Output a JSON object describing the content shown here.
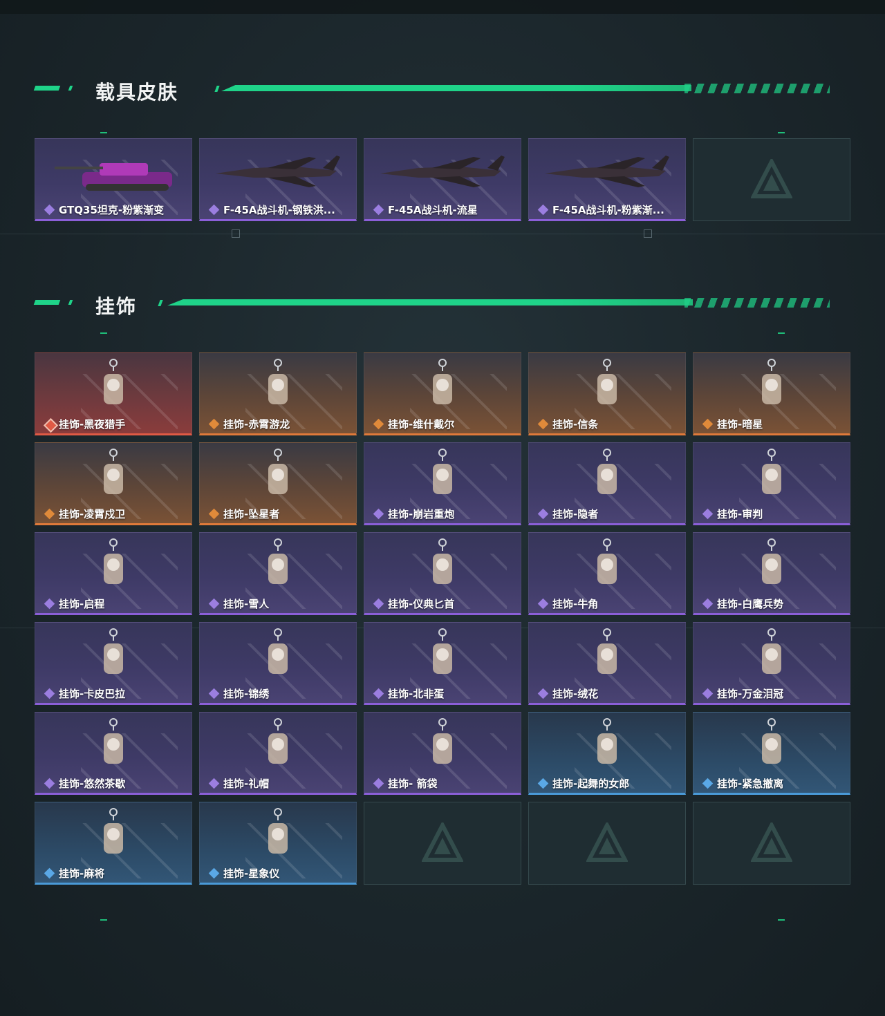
{
  "vehicle_section": {
    "title": "载具皮肤",
    "items": [
      {
        "label": "GTQ35坦克-粉紫渐变",
        "rarity": "purple",
        "icon": "tank-icon"
      },
      {
        "label": "F-45A战斗机-钢铁洪...",
        "rarity": "purple",
        "icon": "jet-icon"
      },
      {
        "label": "F-45A战斗机-流星",
        "rarity": "purple",
        "icon": "jet-icon"
      },
      {
        "label": "F-45A战斗机-粉紫渐...",
        "rarity": "purple",
        "icon": "jet-icon"
      },
      {
        "label": "",
        "rarity": "empty",
        "icon": "empty-slot-logo-icon"
      }
    ]
  },
  "charm_section": {
    "title": "挂饰",
    "items": [
      {
        "label": "挂饰-黑夜猎手",
        "rarity": "red",
        "icon": "figure-charm-icon"
      },
      {
        "label": "挂饰-赤霄游龙",
        "rarity": "orange",
        "icon": "figure-charm-icon"
      },
      {
        "label": "挂饰-维什戴尔",
        "rarity": "orange",
        "icon": "card-charm-icon"
      },
      {
        "label": "挂饰-信条",
        "rarity": "orange",
        "icon": "charm-icon"
      },
      {
        "label": "挂饰-暗星",
        "rarity": "orange",
        "icon": "feather-charm-icon"
      },
      {
        "label": "挂饰-凌霄戍卫",
        "rarity": "orange",
        "icon": "figure-charm-icon"
      },
      {
        "label": "挂饰-坠星者",
        "rarity": "orange",
        "icon": "crystal-charm-icon"
      },
      {
        "label": "挂饰-崩岩重炮",
        "rarity": "purple",
        "icon": "figure-charm-icon"
      },
      {
        "label": "挂饰-隐者",
        "rarity": "purple",
        "icon": "card-charm-icon"
      },
      {
        "label": "挂饰-审判",
        "rarity": "purple",
        "icon": "card-charm-icon"
      },
      {
        "label": "挂饰-启程",
        "rarity": "purple",
        "icon": "ring-charm-icon"
      },
      {
        "label": "挂饰-雪人",
        "rarity": "purple",
        "icon": "snowman-charm-icon"
      },
      {
        "label": "挂饰-仪典匕首",
        "rarity": "purple",
        "icon": "dagger-charm-icon"
      },
      {
        "label": "挂饰-牛角",
        "rarity": "purple",
        "icon": "horn-charm-icon"
      },
      {
        "label": "挂饰-白鹰兵势",
        "rarity": "purple",
        "icon": "text-charm-icon"
      },
      {
        "label": "挂饰-卡皮巴拉",
        "rarity": "purple",
        "icon": "animal-charm-icon"
      },
      {
        "label": "挂饰-锦绣",
        "rarity": "purple",
        "icon": "butterfly-charm-icon"
      },
      {
        "label": "挂饰-北非蛋",
        "rarity": "purple",
        "icon": "food-charm-icon"
      },
      {
        "label": "挂饰-绒花",
        "rarity": "purple",
        "icon": "flower-charm-icon"
      },
      {
        "label": "挂饰-万金泪冠",
        "rarity": "purple",
        "icon": "crown-charm-icon"
      },
      {
        "label": "挂饰-悠然茶歇",
        "rarity": "purple",
        "icon": "cupcake-charm-icon"
      },
      {
        "label": "挂饰-礼帽",
        "rarity": "purple",
        "icon": "hat-charm-icon"
      },
      {
        "label": "挂饰- 箭袋",
        "rarity": "purple",
        "icon": "quiver-charm-icon"
      },
      {
        "label": "挂饰-起舞的女郎",
        "rarity": "blue",
        "icon": "dancer-charm-icon"
      },
      {
        "label": "挂饰-紧急撤离",
        "rarity": "blue",
        "icon": "square-charm-icon"
      },
      {
        "label": "挂饰-麻将",
        "rarity": "blue",
        "icon": "mahjong-charm-icon"
      },
      {
        "label": "挂饰-星象仪",
        "rarity": "blue",
        "icon": "orb-charm-icon"
      },
      {
        "label": "",
        "rarity": "empty",
        "icon": "empty-slot-logo-icon"
      },
      {
        "label": "",
        "rarity": "empty",
        "icon": "empty-slot-logo-icon"
      },
      {
        "label": "",
        "rarity": "empty",
        "icon": "empty-slot-logo-icon"
      }
    ]
  },
  "colors": {
    "accent_green": "#1fd389",
    "rarity_purple": "#8b5fd8",
    "rarity_orange": "#e07a3a",
    "rarity_red": "#e05a45",
    "rarity_blue": "#4a9ad8"
  }
}
